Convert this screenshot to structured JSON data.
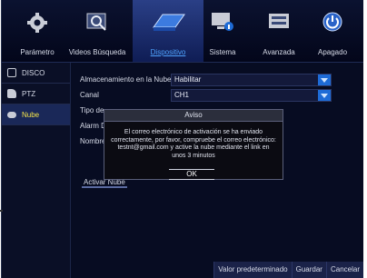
{
  "topbar": {
    "tabs": [
      {
        "label": "Parámetro",
        "icon": "gear-icon"
      },
      {
        "label": "Videos Búsqueda",
        "icon": "video-search-icon"
      },
      {
        "label": "Dispositivo",
        "icon": "hard-drive-icon"
      },
      {
        "label": "Sistema",
        "icon": "monitor-info-icon"
      },
      {
        "label": "Avanzada",
        "icon": "advanced-settings-icon"
      },
      {
        "label": "Apagado",
        "icon": "power-icon"
      }
    ],
    "active_tab": "Dispositivo"
  },
  "sidebar": {
    "items": [
      {
        "label": "DISCO",
        "icon": "disk-icon"
      },
      {
        "label": "PTZ",
        "icon": "ptz-camera-icon"
      },
      {
        "label": "Nube",
        "icon": "cloud-icon"
      }
    ],
    "active_item": "Nube"
  },
  "form": {
    "cloud_storage_label": "Almacenamiento en la Nube",
    "cloud_storage_value": "Habilitar",
    "channel_label": "Canal",
    "channel_value": "CH1",
    "type_label": "Tipo de",
    "alarm_label": "Alarm D",
    "name_label": "Nombre",
    "activate_button": "Activar Nube"
  },
  "footer": {
    "default_button": "Valor predeterminado",
    "save_button": "Guardar",
    "cancel_button": "Cancelar"
  },
  "dialog": {
    "title": "Aviso",
    "message": "El correo electrónico de activación se ha enviado correctamente, por favor, compruebe el correo electrónico: testnt@gmail.com y active la nube mediante el link en unos 3 minutos",
    "ok_button": "OK"
  },
  "colors": {
    "accent": "#1e6bd6",
    "active_text": "#4fa3ff",
    "sidebar_active_text": "#f5e44a"
  }
}
